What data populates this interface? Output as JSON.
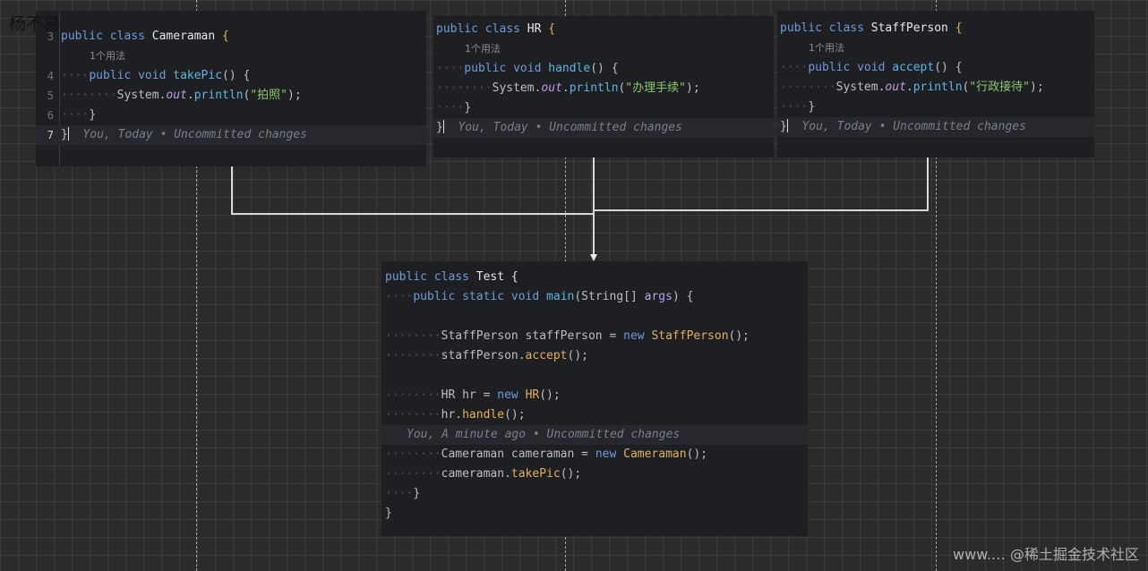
{
  "author": "杨不易",
  "watermark": "www.… @稀土掘金技术社区",
  "cameraman": {
    "l3": [
      "public",
      "class",
      "Cameraman",
      "{"
    ],
    "usage": "1个用法",
    "l4": [
      "public",
      "void",
      "takePic",
      "() {"
    ],
    "l5": [
      "System.",
      "out",
      ".",
      "println",
      "(",
      "\"拍照\"",
      ");"
    ],
    "l6": "}",
    "l7": "}",
    "blame": "You, Today • Uncommitted changes",
    "line_numbers": [
      "3",
      "4",
      "5",
      "6",
      "7"
    ]
  },
  "hr": {
    "l1": [
      "public",
      "class",
      "HR",
      "{"
    ],
    "usage": "1个用法",
    "l2": [
      "public",
      "void",
      "handle",
      "() {"
    ],
    "l3": [
      "System.",
      "out",
      ".",
      "println",
      "(",
      "\"办理手续\"",
      ");"
    ],
    "l4": "}",
    "l5": "}",
    "blame": "You, Today • Uncommitted changes"
  },
  "staff": {
    "l1": [
      "public",
      "class",
      "StaffPerson",
      "{"
    ],
    "usage": "1个用法",
    "l2": [
      "public",
      "void",
      "accept",
      "() {"
    ],
    "l3": [
      "System.",
      "out",
      ".",
      "println",
      "(",
      "\"行政接待\"",
      ");"
    ],
    "l4": "}",
    "l5": "}",
    "blame": "You, Today • Uncommitted changes"
  },
  "test": {
    "l1": [
      "public",
      "class",
      "Test {"
    ],
    "l2": [
      "public",
      "static",
      "void",
      "main",
      "(String[] ",
      "args",
      ") {"
    ],
    "l4": [
      "StaffPerson staffPerson = ",
      "new",
      "StaffPerson",
      "();"
    ],
    "l5": [
      "staffPerson.",
      "accept",
      "();"
    ],
    "l7": [
      "HR hr = ",
      "new",
      "HR",
      "();"
    ],
    "l8": [
      "hr.",
      "handle",
      "();"
    ],
    "blame": "You, A minute ago • Uncommitted changes",
    "l9": [
      "Cameraman cameraman = ",
      "new",
      "Cameraman",
      "();"
    ],
    "l10": [
      "cameraman.",
      "takePic",
      "();"
    ],
    "l11": "}",
    "l12": "}"
  },
  "colors": {
    "canvas": "#2b2b2b",
    "editor": "#1e1f22",
    "keyword": "#6e9bd8",
    "string": "#8cc66d",
    "method": "#e0b15c",
    "static_field": "#c29ce0"
  }
}
